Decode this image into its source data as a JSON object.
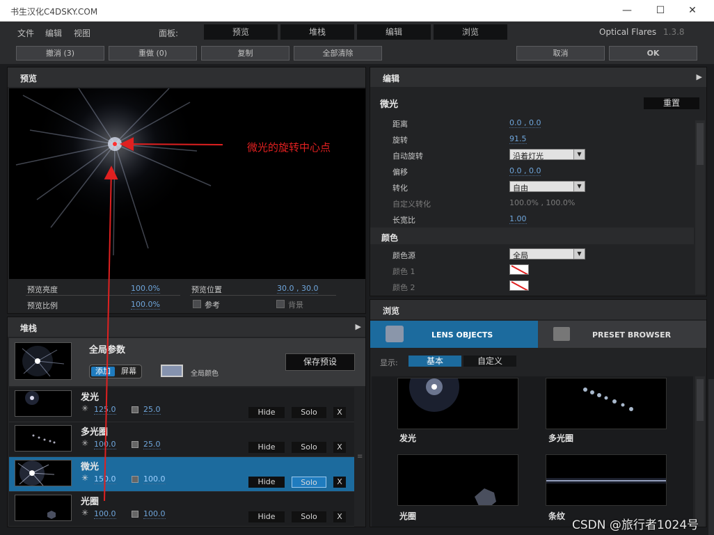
{
  "window": {
    "title": "书生汉化C4DSKY.COM",
    "minimize": "—",
    "maximize": "☐",
    "close": "✕"
  },
  "menu": {
    "items": [
      "文件",
      "编辑",
      "视图"
    ],
    "panel_label": "面板:",
    "panel_tabs": [
      "预览",
      "堆栈",
      "编辑",
      "浏览"
    ],
    "product": "Optical Flares",
    "version": "1.3.8"
  },
  "toolbar": {
    "undo": "撤消 (3)",
    "redo": "重做 (0)",
    "copy": "复制",
    "clear_all": "全部清除",
    "cancel": "取消",
    "ok": "OK"
  },
  "preview": {
    "header": "预览",
    "annotation": "微光的旋转中心点",
    "brightness_label": "预览亮度",
    "brightness_value": "100.0%",
    "position_label": "预览位置",
    "position_value": "30.0 , 30.0",
    "scale_label": "预览比例",
    "scale_value": "100.0%",
    "reference_label": "参考",
    "background_label": "背景"
  },
  "stack": {
    "header": "堆栈",
    "global": {
      "title": "全局参数",
      "mode_add": "添加",
      "mode_screen": "屏幕",
      "color_label": "全局颜色",
      "save_preset": "保存预设"
    },
    "rows": [
      {
        "name": "发光",
        "brightness": "125.0",
        "scale": "25.0",
        "hide": "Hide",
        "solo": "Solo",
        "x": "X",
        "selected": false
      },
      {
        "name": "多光圈",
        "brightness": "100.0",
        "scale": "25.0",
        "hide": "Hide",
        "solo": "Solo",
        "x": "X",
        "selected": false
      },
      {
        "name": "微光",
        "brightness": "150.0",
        "scale": "100.0",
        "hide": "Hide",
        "solo": "Solo",
        "x": "X",
        "selected": true
      },
      {
        "name": "光圈",
        "brightness": "100.0",
        "scale": "100.0",
        "hide": "Hide",
        "solo": "Solo",
        "x": "X",
        "selected": false
      }
    ]
  },
  "editor": {
    "header": "编辑",
    "object_name": "微光",
    "reset": "重置",
    "fields": [
      {
        "label": "距离",
        "value": "0.0 , 0.0"
      },
      {
        "label": "旋转",
        "value": "91.5"
      },
      {
        "label": "自动旋转",
        "value": "沿着灯光"
      },
      {
        "label": "偏移",
        "value": "0.0 , 0.0"
      },
      {
        "label": "转化",
        "value": "自由"
      },
      {
        "label": "自定义转化",
        "value": "100.0% , 100.0%"
      },
      {
        "label": "长宽比",
        "value": "1.00"
      }
    ],
    "color_section": "颜色",
    "color_source_label": "颜色源",
    "color_source_value": "全局",
    "color1_label": "颜色 1",
    "color2_label": "颜色 2"
  },
  "browser": {
    "header": "浏览",
    "tab_lens": "LENS OBJECTS",
    "tab_preset": "PRESET BROWSER",
    "display_label": "显示:",
    "display_basic": "基本",
    "display_custom": "自定义",
    "items": [
      "发光",
      "多光圈",
      "光圈",
      "条纹"
    ]
  },
  "watermark": "CSDN @旅行者1024号",
  "colors": {
    "accent": "#1c6b9e",
    "value_blue": "#6fa6dc",
    "annotation_red": "#e02020"
  }
}
